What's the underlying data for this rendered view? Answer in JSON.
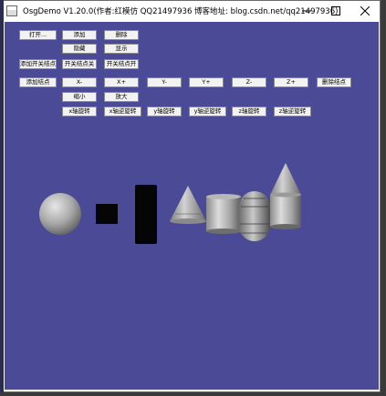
{
  "window": {
    "title": "OsgDemo V1.20.0(作者:红模仿 QQ21497936 博客地址: blog.csdn.net/qq21497936)",
    "controls": [
      "minimize",
      "maximize",
      "close"
    ]
  },
  "toolbar": {
    "row1": [
      "打开...",
      "添加",
      "删除"
    ],
    "row2": [
      "隐藏",
      "显示"
    ],
    "row3": [
      "添加开关结点",
      "开关结点关",
      "开关结点开"
    ],
    "row4": [
      "添加结点",
      "X-",
      "X+",
      "Y-",
      "Y+",
      "Z-",
      "Z+",
      "删除结点"
    ],
    "row5": [
      "缩小",
      "放大"
    ],
    "row6": [
      "x轴旋转",
      "x轴逆旋转",
      "y轴旋转",
      "y轴逆旋转",
      "z轴旋转",
      "z轴逆旋转"
    ]
  },
  "scene": {
    "background": "#4a4a96",
    "objects": [
      "sphere",
      "cube",
      "box",
      "cone",
      "cylinder",
      "capsule",
      "cylinder-with-cone"
    ]
  }
}
